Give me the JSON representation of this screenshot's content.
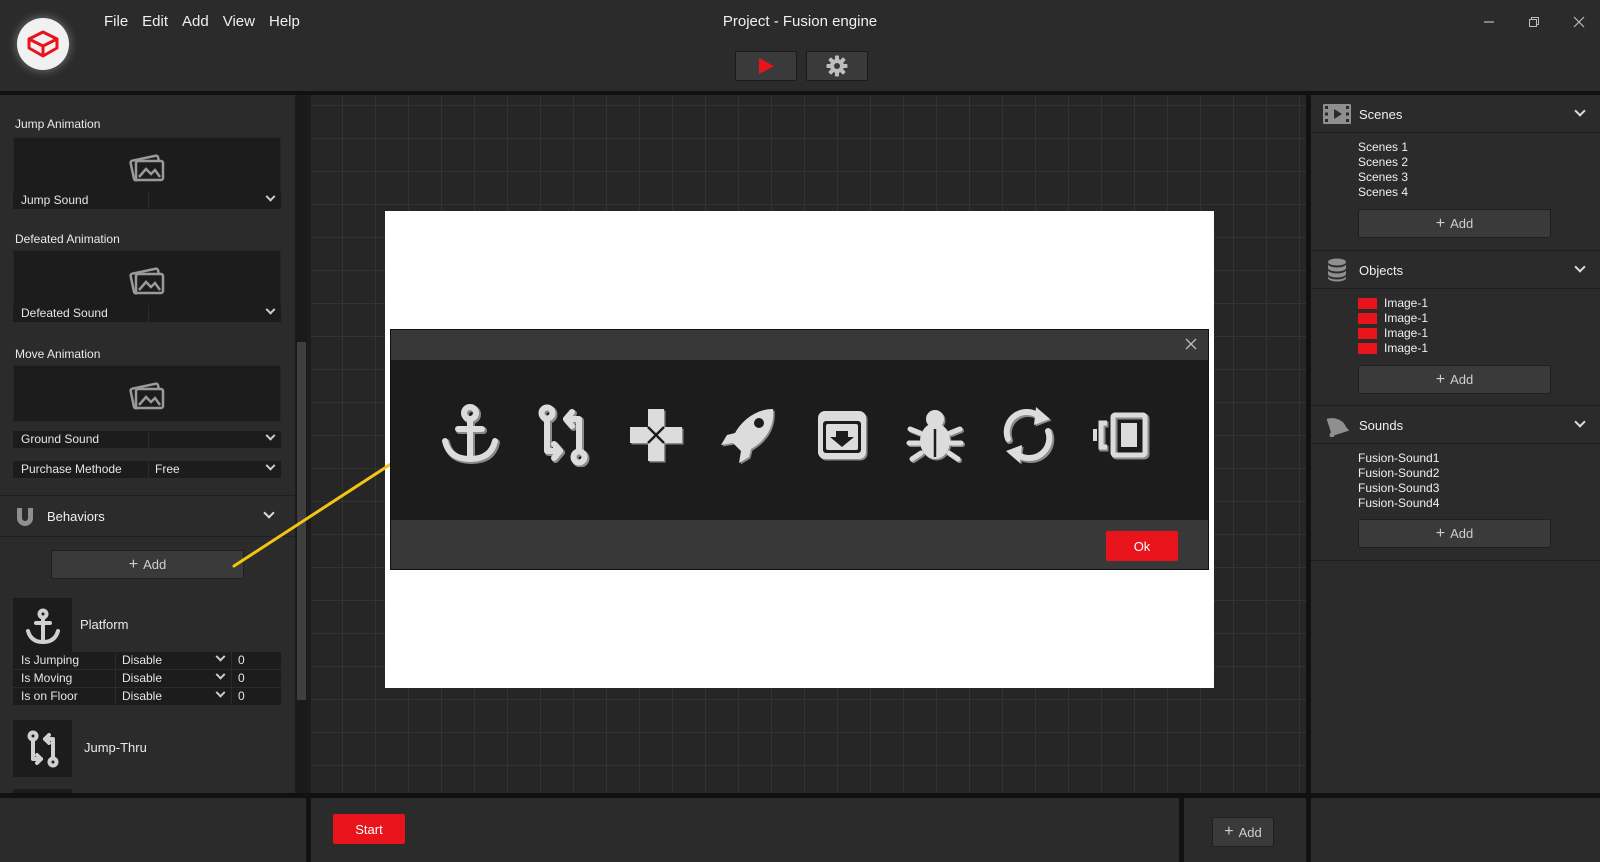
{
  "app": {
    "title": "Project - Fusion engine",
    "menu": [
      "File",
      "Edit",
      "Add",
      "View",
      "Help"
    ]
  },
  "left_panel": {
    "jump": {
      "animation_label": "Jump Animation",
      "sound_label": "Jump Sound",
      "sound_value": ""
    },
    "defeated": {
      "animation_label": "Defeated Animation",
      "sound_label": "Defeated Sound",
      "sound_value": ""
    },
    "move": {
      "animation_label": "Move Animation"
    },
    "ground_sound": {
      "label": "Ground Sound",
      "value": ""
    },
    "purchase": {
      "label": "Purchase Methode",
      "value": "Free"
    },
    "behaviors": {
      "title": "Behaviors",
      "add_label": "Add",
      "platform": {
        "name": "Platform",
        "rows": [
          {
            "label": "Is Jumping",
            "value": "Disable",
            "count": "0"
          },
          {
            "label": "Is Moving",
            "value": "Disable",
            "count": "0"
          },
          {
            "label": "Is on Floor",
            "value": "Disable",
            "count": "0"
          }
        ]
      },
      "jump_thru": {
        "name": "Jump-Thru"
      }
    }
  },
  "modal": {
    "ok_label": "Ok",
    "icons": [
      "anchor-icon",
      "jump-thru-icon",
      "gamepad-icon",
      "rocket-icon",
      "archive-icon",
      "bug-icon",
      "refresh-icon",
      "resize-icon"
    ]
  },
  "right_panel": {
    "scenes": {
      "title": "Scenes",
      "items": [
        "Scenes 1",
        "Scenes 2",
        "Scenes 3",
        "Scenes 4"
      ],
      "add_label": "Add"
    },
    "objects": {
      "title": "Objects",
      "items": [
        "Image-1",
        "Image-1",
        "Image-1",
        "Image-1"
      ],
      "add_label": "Add",
      "swatch_color": "#e8131b"
    },
    "sounds": {
      "title": "Sounds",
      "items": [
        "Fusion-Sound1",
        "Fusion-Sound2",
        "Fusion-Sound3",
        "Fusion-Sound4"
      ],
      "add_label": "Add"
    }
  },
  "bottom": {
    "start_label": "Start",
    "add_label": "Add"
  },
  "colors": {
    "accent": "#e8131b",
    "panel": "#2b2b2b",
    "canvas": "#262626"
  }
}
